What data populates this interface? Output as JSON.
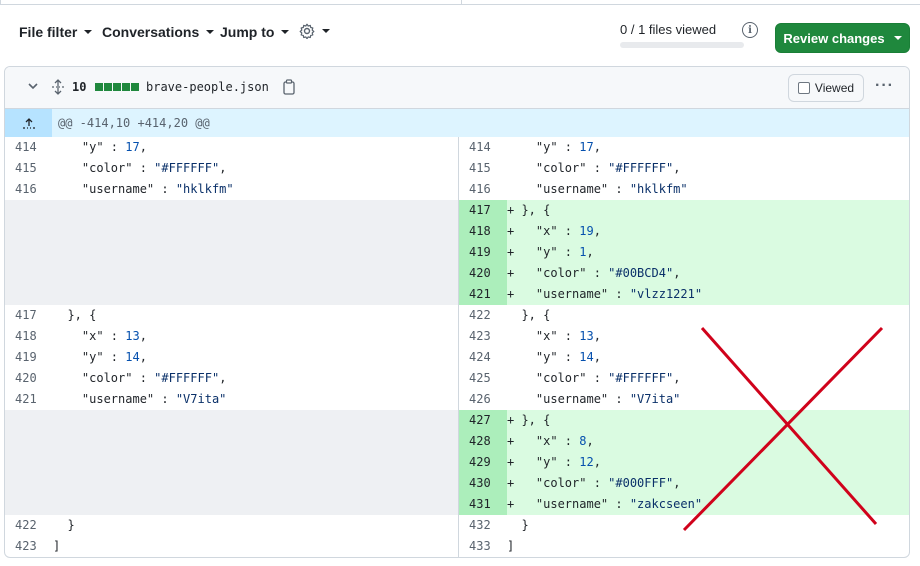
{
  "toolbar": {
    "file_filter": "File filter",
    "conversations": "Conversations",
    "jump_to": "Jump to",
    "files_viewed": "0 / 1 files viewed",
    "review_changes": "Review changes",
    "settings_icon": "gear-icon",
    "info_icon": "info-icon"
  },
  "file": {
    "changes_count": "10",
    "diffstat_blocks": 5,
    "filename": "brave-people.json",
    "viewed_label": "Viewed",
    "kebab": "···"
  },
  "hunk": {
    "header": "@@ -414,10 +414,20 @@"
  },
  "rows": [
    {
      "l": "414",
      "lc": "    \"y\" : 17,",
      "r": "414",
      "rc": "    \"y\" : 17,",
      "type": "ctx"
    },
    {
      "l": "415",
      "lc": "    \"color\" : \"#FFFFFF\",",
      "r": "415",
      "rc": "    \"color\" : \"#FFFFFF\",",
      "type": "ctx"
    },
    {
      "l": "416",
      "lc": "    \"username\" : \"hklkfm\"",
      "r": "416",
      "rc": "    \"username\" : \"hklkfm\"",
      "type": "ctx"
    },
    {
      "l": "",
      "lc": "",
      "r": "417",
      "rc": "+ }, {",
      "type": "add"
    },
    {
      "l": "",
      "lc": "",
      "r": "418",
      "rc": "+   \"x\" : 19,",
      "type": "add"
    },
    {
      "l": "",
      "lc": "",
      "r": "419",
      "rc": "+   \"y\" : 1,",
      "type": "add"
    },
    {
      "l": "",
      "lc": "",
      "r": "420",
      "rc": "+   \"color\" : \"#00BCD4\",",
      "type": "add"
    },
    {
      "l": "",
      "lc": "",
      "r": "421",
      "rc": "+   \"username\" : \"vlzz1221\"",
      "type": "add"
    },
    {
      "l": "417",
      "lc": "  }, {",
      "r": "422",
      "rc": "  }, {",
      "type": "ctx"
    },
    {
      "l": "418",
      "lc": "    \"x\" : 13,",
      "r": "423",
      "rc": "    \"x\" : 13,",
      "type": "ctx"
    },
    {
      "l": "419",
      "lc": "    \"y\" : 14,",
      "r": "424",
      "rc": "    \"y\" : 14,",
      "type": "ctx"
    },
    {
      "l": "420",
      "lc": "    \"color\" : \"#FFFFFF\",",
      "r": "425",
      "rc": "    \"color\" : \"#FFFFFF\",",
      "type": "ctx"
    },
    {
      "l": "421",
      "lc": "    \"username\" : \"V7ita\"",
      "r": "426",
      "rc": "    \"username\" : \"V7ita\"",
      "type": "ctx"
    },
    {
      "l": "",
      "lc": "",
      "r": "427",
      "rc": "+ }, {",
      "type": "add"
    },
    {
      "l": "",
      "lc": "",
      "r": "428",
      "rc": "+   \"x\" : 8,",
      "type": "add"
    },
    {
      "l": "",
      "lc": "",
      "r": "429",
      "rc": "+   \"y\" : 12,",
      "type": "add"
    },
    {
      "l": "",
      "lc": "",
      "r": "430",
      "rc": "+   \"color\" : \"#000FFF\",",
      "type": "add"
    },
    {
      "l": "",
      "lc": "",
      "r": "431",
      "rc": "+   \"username\" : \"zakcseen\"",
      "type": "add"
    },
    {
      "l": "422",
      "lc": "  }",
      "r": "432",
      "rc": "  }",
      "type": "ctx"
    },
    {
      "l": "423",
      "lc": "]",
      "r": "433",
      "rc": "]",
      "type": "ctx"
    }
  ],
  "colors": {
    "review_button": "#1f883d",
    "added_line_bg": "#dafbe1",
    "added_num_bg": "#aceebb",
    "hunk_bg": "#ddf4ff",
    "annotation_x": "#d0021b"
  }
}
